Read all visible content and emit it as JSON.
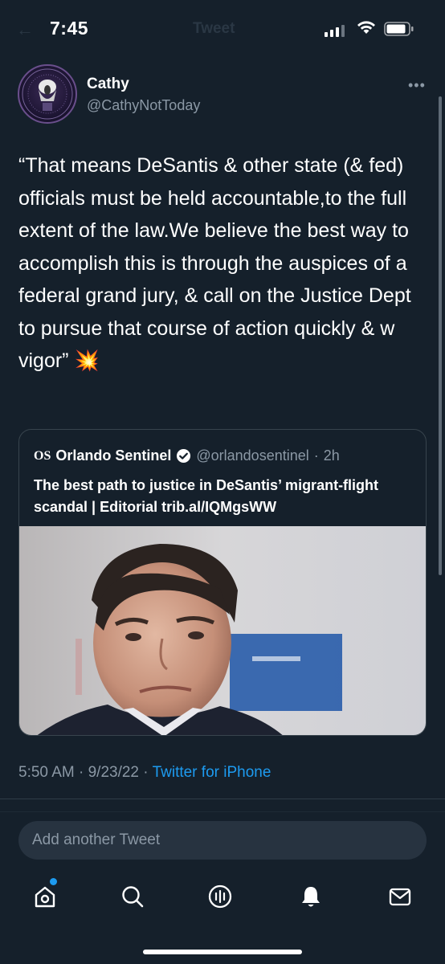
{
  "status_bar": {
    "time": "7:45",
    "ghost_title": "Tweet"
  },
  "author": {
    "name": "Cathy",
    "handle": "@CathyNotToday"
  },
  "tweet": {
    "text": "“That means DeSantis & other state (& fed) officials must be held accountable,to the full extent of the law.We believe the best way to accomplish this is through the auspices of a federal grand jury, & call on the Justice Dept to pursue that course of action quickly & w vigor” 💥"
  },
  "quote": {
    "logo": "OS",
    "name": "Orlando Sentinel",
    "handle": "@orlandosentinel",
    "separator": "·",
    "age": "2h",
    "text": "The best path to justice in DeSantis’ migrant-flight scandal | Editorial trib.al/IQMgsWW"
  },
  "meta": {
    "time": "5:50 AM",
    "date": "9/23/22",
    "sep": "·",
    "source": "Twitter for iPhone"
  },
  "reply": {
    "placeholder": "Add another Tweet"
  },
  "colors": {
    "background": "#15202b",
    "accent": "#1d9bf0",
    "muted": "#8b98a5"
  },
  "icons": {
    "tabs": [
      "home-icon",
      "search-icon",
      "spaces-icon",
      "notifications-icon",
      "messages-icon"
    ],
    "header": "more-icon"
  }
}
